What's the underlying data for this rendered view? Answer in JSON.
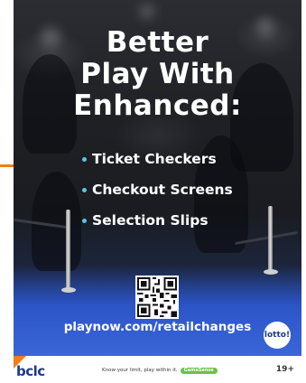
{
  "poster": {
    "headline": [
      "Better",
      "Play With",
      "Enhanced:"
    ],
    "bullets": [
      "Ticket Checkers",
      "Checkout Screens",
      "Selection Slips"
    ],
    "url": "playnow.com/retailchanges",
    "lotto_badge": "lotto!"
  },
  "footer": {
    "brand": "bclc",
    "tagline": "Know your limit, play within it.",
    "gamesense": "GameSense",
    "age": "19+"
  },
  "colors": {
    "accent_orange": "#f07d1e",
    "floor_blue": "#2c55c8",
    "bullet_cyan": "#5bc4e8",
    "brand_navy": "#1d3a8a",
    "gamesense_green": "#6cc24a"
  }
}
